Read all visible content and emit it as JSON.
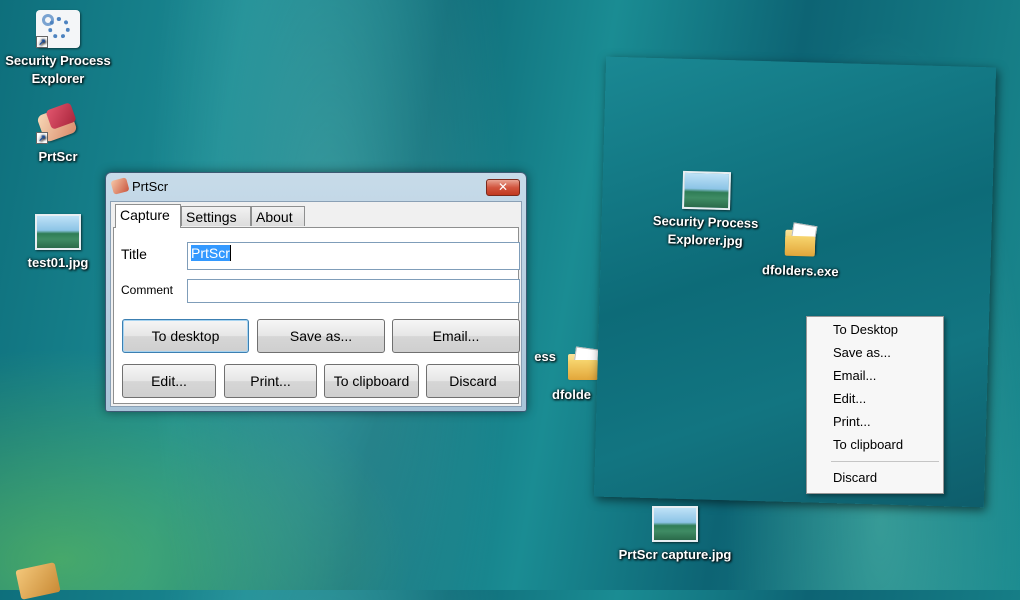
{
  "desktop": {
    "icons": [
      {
        "label_line1": "Security Process",
        "label_line2": "Explorer",
        "icon": "security-process-explorer-icon"
      },
      {
        "label_line1": "PrtScr",
        "label_line2": "",
        "icon": "prtscr-app-icon"
      },
      {
        "label_line1": "test01.jpg",
        "label_line2": "",
        "icon": "image-file-icon"
      },
      {
        "label_line1": "ess",
        "label_line2": "",
        "icon": "partial-label"
      },
      {
        "label_line1": "dfolde",
        "label_line2": "",
        "icon": "folder-exe-icon"
      }
    ]
  },
  "dialog": {
    "title": "PrtScr",
    "close_symbol": "✕",
    "tabs": [
      "Capture",
      "Settings",
      "About"
    ],
    "active_tab": "Capture",
    "title_label": "Title",
    "title_value": "PrtScr",
    "comment_label": "Comment",
    "comment_value": "",
    "buttons_row1": [
      "To desktop",
      "Save as...",
      "Email..."
    ],
    "buttons_row2": [
      "Edit...",
      "Print...",
      "To clipboard",
      "Discard"
    ]
  },
  "preview": {
    "icons": [
      {
        "label_line1": "Security Process",
        "label_line2": "Explorer.jpg",
        "icon": "image-file-icon"
      },
      {
        "label_line1": "dfolders.exe",
        "label_line2": "",
        "icon": "folder-exe-icon"
      }
    ],
    "context_menu": {
      "items": [
        "To Desktop",
        "Save as...",
        "Email...",
        "Edit...",
        "Print...",
        "To clipboard"
      ],
      "last_item": "Discard"
    }
  },
  "bottom_icon": {
    "label": "PrtScr capture.jpg",
    "icon": "image-file-icon"
  }
}
